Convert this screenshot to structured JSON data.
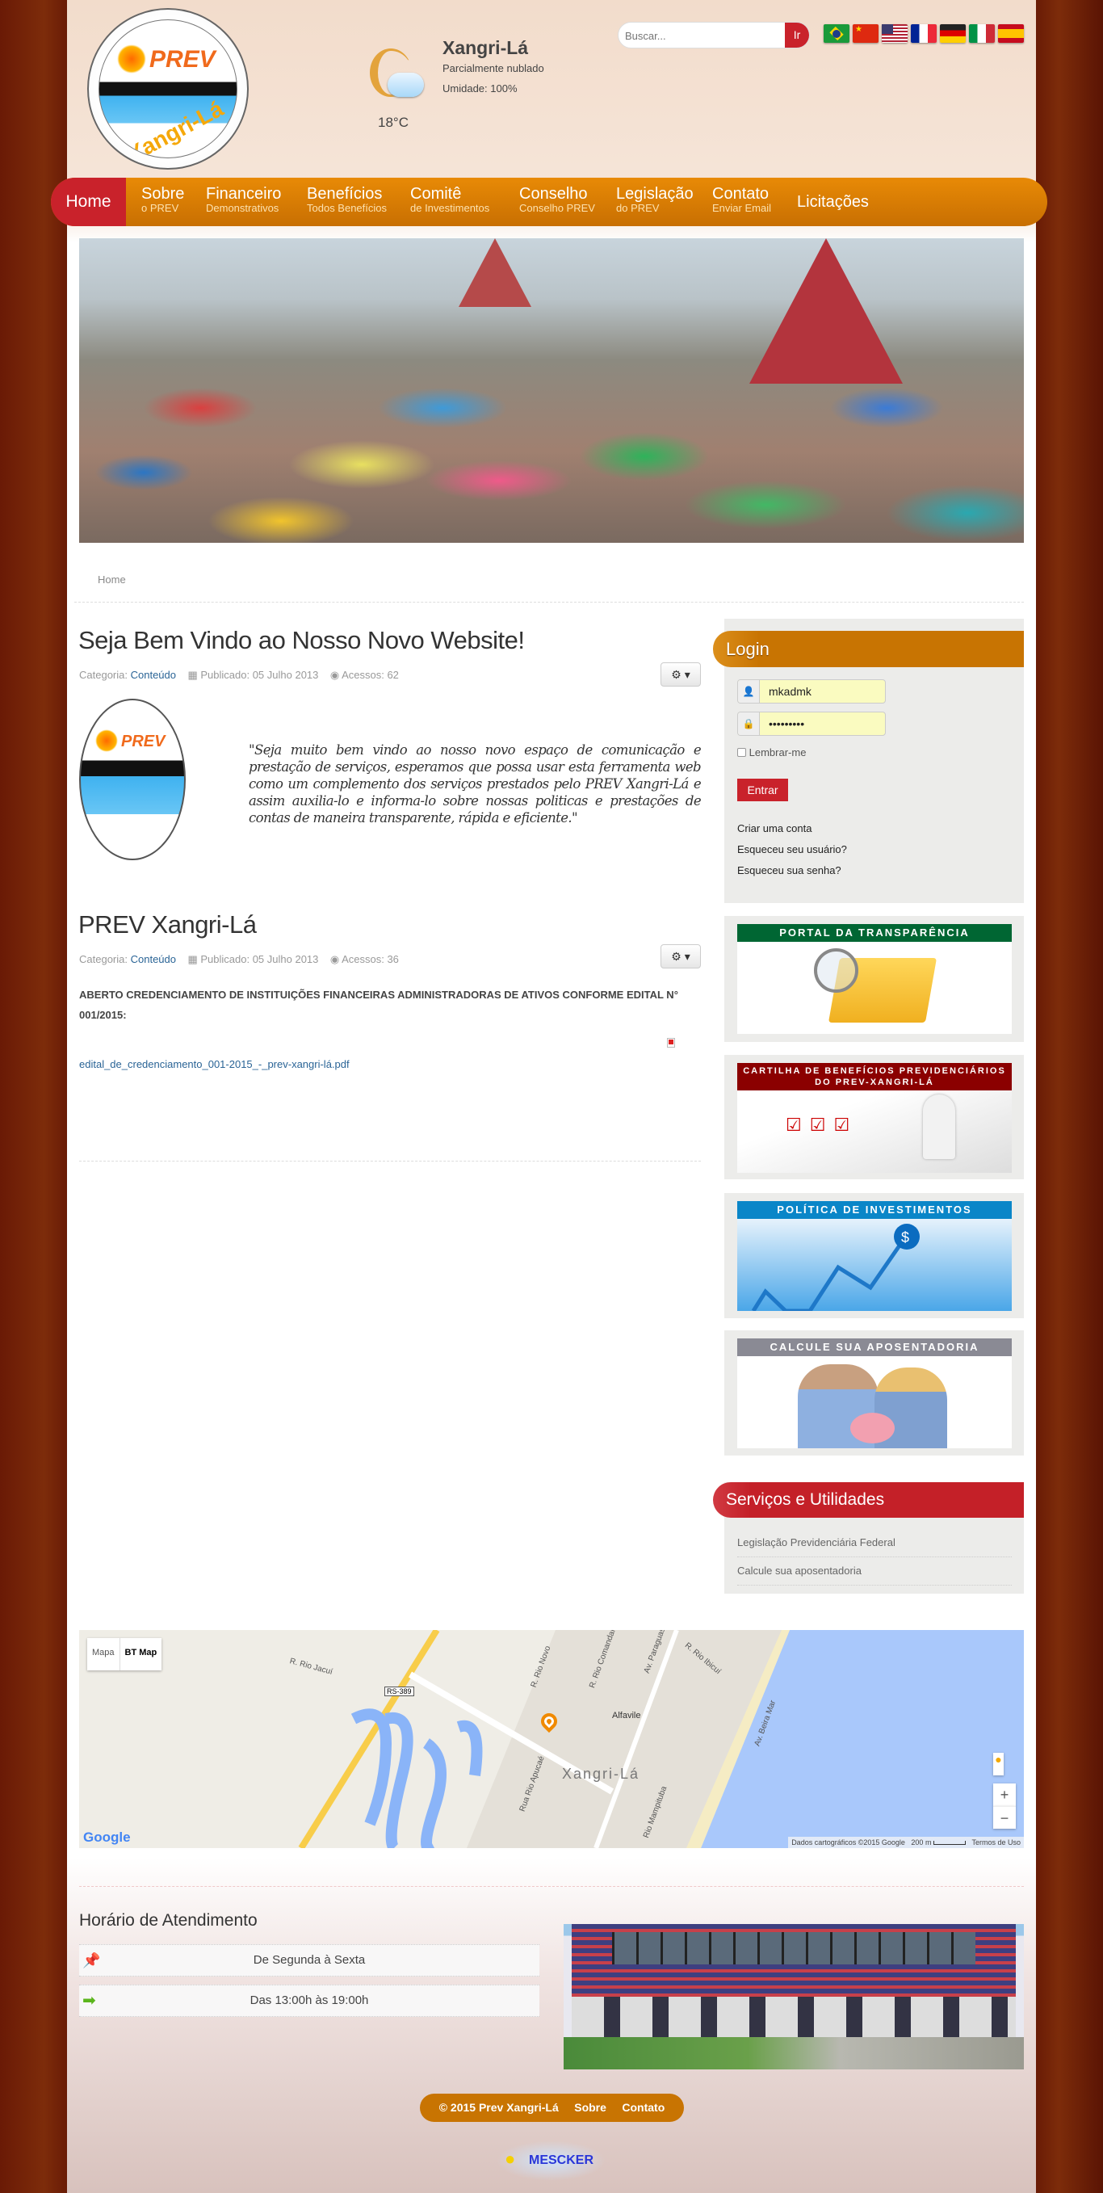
{
  "header": {
    "logo_text": [
      "PREV",
      "Xangri-Lá"
    ],
    "weather": {
      "city": "Xangri-Lá",
      "condition": "Parcialmente nublado",
      "humidity": "Umidade: 100%",
      "temperature": "18°C",
      "icon": "partly-cloudy-night-icon"
    },
    "search": {
      "placeholder": "Buscar...",
      "button": "Ir"
    },
    "flags": [
      "brazil",
      "china",
      "usa",
      "france",
      "germany",
      "italy",
      "spain"
    ]
  },
  "nav": {
    "items": [
      {
        "label": "Home",
        "sub": ""
      },
      {
        "label": "Sobre",
        "sub": "o PREV"
      },
      {
        "label": "Financeiro",
        "sub": "Demonstrativos"
      },
      {
        "label": "Benefícios",
        "sub": "Todos Benefícios"
      },
      {
        "label": "Comitê",
        "sub": "de Investimentos"
      },
      {
        "label": "Conselho",
        "sub": "Conselho PREV"
      },
      {
        "label": "Legislação",
        "sub": "do PREV"
      },
      {
        "label": "Contato",
        "sub": "Enviar Email"
      },
      {
        "label": "Licitações",
        "sub": ""
      }
    ]
  },
  "breadcrumb": "Home",
  "articles": [
    {
      "title": "Seja Bem Vindo ao Nosso Novo Website!",
      "category_label": "Categoria:",
      "category": "Conteúdo",
      "published": "Publicado: 05 Julho 2013",
      "hits": "Acessos: 62",
      "body": "\"Seja muito bem vindo ao nosso novo espaço de comunicação e prestação de serviços, esperamos que possa usar esta ferramenta web como um complemento dos serviços prestados pelo PREV Xangri-Lá e assim auxilia-lo e informa-lo sobre nossas politicas e prestações de contas de maneira transparente, rápida e eficiente.\""
    },
    {
      "title": "PREV Xangri-Lá",
      "category_label": "Categoria:",
      "category": "Conteúdo",
      "published": "Publicado: 05 Julho 2013",
      "hits": "Acessos: 36",
      "body": "ABERTO CREDENCIAMENTO DE INSTITUIÇÕES FINANCEIRAS ADMINISTRADORAS DE ATIVOS CONFORME EDITAL N° 001/2015:",
      "attachment": "edital_de_credenciamento_001-2015_-_prev-xangri-lá.pdf"
    }
  ],
  "login": {
    "title": "Login",
    "username": "mkadmk",
    "password": "•••••••••",
    "remember": "Lembrar-me",
    "submit": "Entrar",
    "links": [
      "Criar uma conta",
      "Esqueceu seu usuário?",
      "Esqueceu sua senha?"
    ]
  },
  "banners": [
    {
      "title": "PORTAL DA TRANSPARÊNCIA",
      "color": "#006633"
    },
    {
      "title": "CARTILHA DE BENEFÍCIOS PREVIDENCIÁRIOS DO PREV-XANGRI-LÁ",
      "color": "#8b0000"
    },
    {
      "title": "POLÍTICA DE INVESTIMENTOS",
      "color": "#0a86c8"
    },
    {
      "title": "CALCULE SUA APOSENTADORIA",
      "color": "#8a8a94"
    }
  ],
  "services": {
    "title": "Serviços e Utilidades",
    "items": [
      "Legislação Previdenciária Federal",
      "Calcule sua aposentadoria"
    ]
  },
  "map": {
    "type_buttons": [
      "Mapa",
      "BT Map"
    ],
    "labels": [
      "R. Rio Jacuí",
      "RS-389",
      "R. Rio Novo",
      "R. Rio Comandaí",
      "Av. Paraguassu",
      "R. Rio Ibicuí",
      "Alfavile",
      "Xangri-Lá",
      "Rua Rio Apucaé",
      "Rio Mampituba",
      "Av. Beira Mar"
    ],
    "attribution": "Dados cartográficos ©2015 Google",
    "scale": "200 m",
    "terms": "Termos de Uso",
    "logo": "Google"
  },
  "hours": {
    "title": "Horário de Atendimento",
    "rows": [
      "De Segunda à Sexta",
      "Das 13:00h às 19:00h"
    ]
  },
  "footer": {
    "copyright": "© 2015 Prev Xangri-Lá",
    "links": [
      "Sobre",
      "Contato"
    ],
    "credit_logo": "MESCKER"
  },
  "colors": {
    "nav": "#e38405",
    "home": "#c9222b",
    "login_header": "#c87402",
    "services_header": "#c42028"
  }
}
